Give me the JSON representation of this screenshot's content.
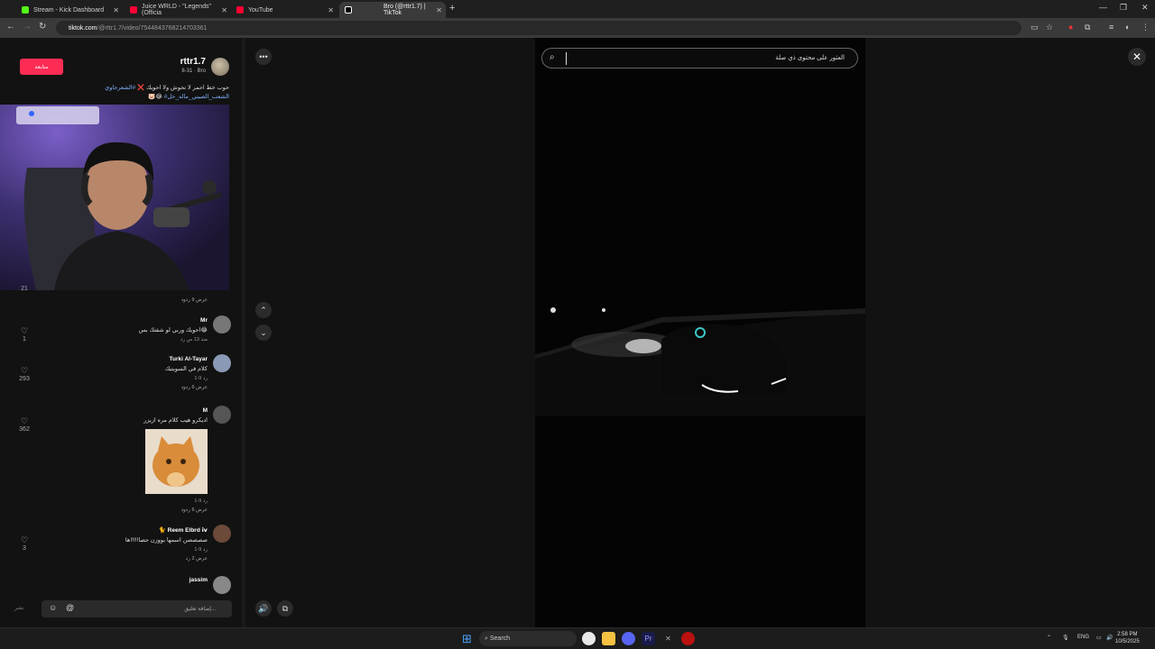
{
  "tabs": [
    {
      "title": "Stream - Kick Dashboard",
      "color": "#53fc18"
    },
    {
      "title": "Juice WRLD - \"Legends\" (Officia",
      "color": "#ff0033"
    },
    {
      "title": "YouTube",
      "color": "#ff0033"
    },
    {
      "title": "Bro (@rttr1.7) | TikTok",
      "color": "#ffffff"
    }
  ],
  "address": {
    "host": "tiktok.com",
    "path": "/@rttr1.7/video/7544843768214703361"
  },
  "post": {
    "username": "rttr1.7",
    "meta": "8-31 · Bro",
    "follow_label": "متابعة",
    "caption_line1": "حوب خط احمر لا تحوش ولا احويك ❌",
    "caption_tag1": "#الشعرجاوي",
    "caption_tag2": "#الشعب_الصيني_ماله_حل",
    "caption_emoji": "🐷😂"
  },
  "comments": [
    {
      "name": "",
      "text": "",
      "meta": "",
      "replies": "عرض 9 ردود",
      "likes": "21"
    },
    {
      "name": "Mr",
      "text": "احويك وربي لو شفتك بس😂",
      "meta": "منذ 13 س   رد",
      "replies": "",
      "likes": "1"
    },
    {
      "name": "Turki Al-Tayar",
      "text": "كلام في السويتيك",
      "meta": "1-9   رد",
      "replies": "عرض 6 ردود",
      "likes": "293"
    },
    {
      "name": "M",
      "text": "اديكرو هيب كلام مره ازيزر",
      "meta": "1-9   رد",
      "replies": "عرض 6 ردود",
      "likes": "362"
    },
    {
      "name": "🐈 Reem Elbrd ⅳ",
      "text": "صصصصن اسمها بووزن حصا!!!!!ها",
      "meta": "1-9   رد",
      "replies": "عرض 2 رد",
      "likes": "3"
    },
    {
      "name": "jassim",
      "text": "",
      "meta": "",
      "replies": "",
      "likes": ""
    }
  ],
  "comment_input": {
    "placeholder": "إضافة تعليق...",
    "post_label": "نشر"
  },
  "search": {
    "placeholder": "العثور على محتوى ذي صلة"
  },
  "taskbar": {
    "search_label": "Search",
    "lang": "ENG",
    "time": "2:58 PM",
    "date": "10/5/2025"
  }
}
